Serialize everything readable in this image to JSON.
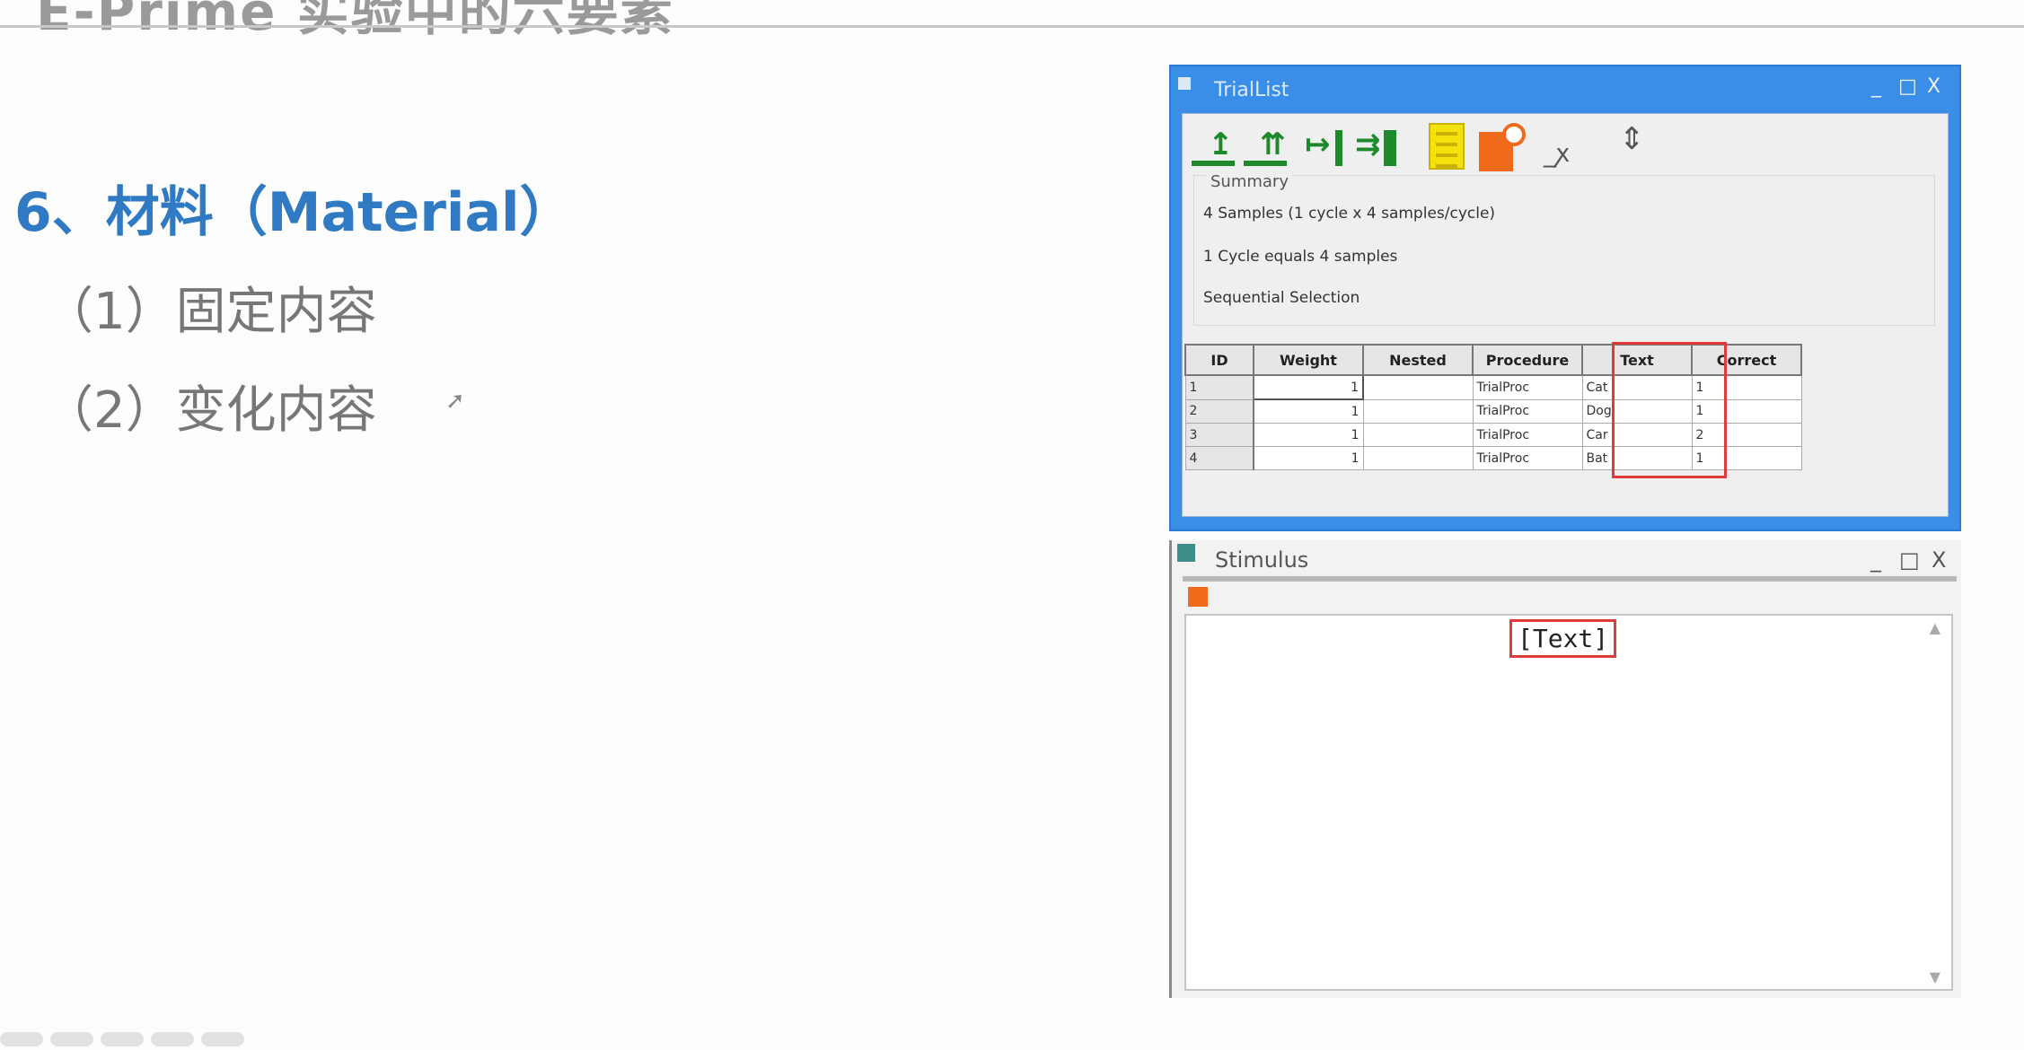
{
  "slide": {
    "top_title": "E-Prime 实验中的六要素",
    "heading": "6、材料（Material）",
    "bullets": [
      "（1）固定内容",
      "（2）变化内容"
    ]
  },
  "triallist": {
    "title": "TrialList",
    "controls": [
      "_",
      "□",
      "X"
    ],
    "toolbar_icons": [
      "add-level-icon",
      "add-multiple-levels-icon",
      "add-attribute-icon",
      "add-multiple-attributes-icon",
      "properties-icon",
      "summary-icon",
      "remove-icon",
      "expand-icon"
    ],
    "summary": {
      "label": "Summary",
      "line1": "4 Samples (1 cycle x 4 samples/cycle)",
      "line2": "1 Cycle equals 4 samples",
      "line3": "Sequential Selection"
    },
    "columns": [
      "ID",
      "Weight",
      "Nested",
      "Procedure",
      "Text",
      "Correct"
    ],
    "rows": [
      {
        "id": "1",
        "weight": "1",
        "nested": "",
        "procedure": "TrialProc",
        "text": "Cat",
        "correct": "1"
      },
      {
        "id": "2",
        "weight": "1",
        "nested": "",
        "procedure": "TrialProc",
        "text": "Dog",
        "correct": "1"
      },
      {
        "id": "3",
        "weight": "1",
        "nested": "",
        "procedure": "TrialProc",
        "text": "Car",
        "correct": "2"
      },
      {
        "id": "4",
        "weight": "1",
        "nested": "",
        "procedure": "TrialProc",
        "text": "Bat",
        "correct": "1"
      }
    ]
  },
  "stimulus": {
    "title": "Stimulus",
    "controls": [
      "_",
      "□",
      "X"
    ],
    "canvas_text": "[Text]"
  }
}
